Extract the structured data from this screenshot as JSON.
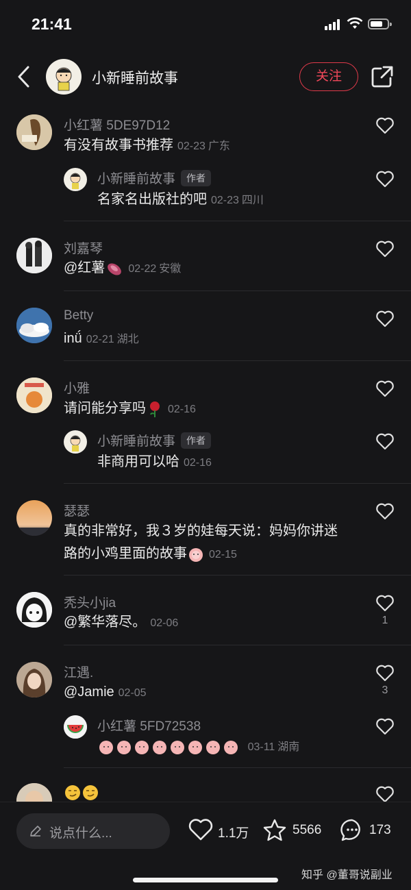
{
  "status_bar": {
    "time": "21:41"
  },
  "header": {
    "title": "小新睡前故事",
    "follow_label": "关注"
  },
  "comments": [
    {
      "user": "小红薯 5DE97D12",
      "text": "有没有故事书推荐",
      "date": "02-23",
      "location": "广东",
      "likes": ""
    },
    {
      "user": "小新睡前故事",
      "tag": "作者",
      "text": "名家名出版社的吧",
      "date": "02-23",
      "location": "四川",
      "likes": ""
    },
    {
      "user": "刘嘉琴",
      "text": "@红薯",
      "date": "02-22",
      "location": "安徽",
      "likes": ""
    },
    {
      "user": "Betty",
      "text": "inǘ",
      "date": "02-21",
      "location": "湖北",
      "likes": ""
    },
    {
      "user": "小雅",
      "text": "请问能分享吗",
      "date": "02-16",
      "location": "",
      "likes": ""
    },
    {
      "user": "小新睡前故事",
      "tag": "作者",
      "text": "非商用可以哈",
      "date": "02-16",
      "location": "",
      "likes": ""
    },
    {
      "user": "瑟瑟",
      "text": "真的非常好，我３岁的娃每天说：妈妈你讲迷",
      "text2": "路的小鸡里面的故事",
      "date": "02-15",
      "location": "",
      "likes": ""
    },
    {
      "user": "秃头小jia",
      "text": "@繁华落尽。",
      "date": "02-06",
      "location": "",
      "likes": "1"
    },
    {
      "user": "江遇.",
      "text": "@Jamie",
      "date": "02-05",
      "location": "",
      "likes": "3"
    },
    {
      "user": "小红薯 5FD72538",
      "text": "",
      "date": "03-11",
      "location": "湖南",
      "likes": ""
    }
  ],
  "bottom_bar": {
    "input_placeholder": "说点什么...",
    "likes": "1.1万",
    "favorites": "5566",
    "comments": "173",
    "watermark": "知乎 @董哥说副业"
  },
  "colors": {
    "background": "#161618",
    "accent": "#e03a4a"
  }
}
